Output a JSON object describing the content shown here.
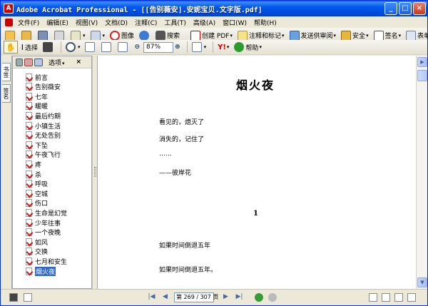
{
  "window": {
    "title": "Adobe Acrobat Professional - [[告别薇安].安妮宝贝.文字版.pdf]",
    "app_icon": "A"
  },
  "menu": [
    "文件(F)",
    "编辑(E)",
    "视图(V)",
    "文档(D)",
    "注释(C)",
    "工具(T)",
    "高级(A)",
    "窗口(W)",
    "帮助(H)"
  ],
  "toolbar1": {
    "picture_label": "图像",
    "search_label": "搜索",
    "create_pdf_label": "创建 PDF",
    "comment_label": "注释和标记",
    "review_label": "发送供审阅",
    "security_label": "安全",
    "sign_label": "签名",
    "forms_label": "表单"
  },
  "toolbar2": {
    "select_label": "选择",
    "zoom_value": "87%",
    "help_label": "帮助"
  },
  "panel": {
    "options_label": "选项",
    "close_glyph": "×",
    "tab1": "书签",
    "tab2": "签名",
    "bookmarks": [
      "前言",
      "告别薇安",
      "七年",
      "暖暖",
      "最后约期",
      "小镇生活",
      "无处告别",
      "下坠",
      "午夜飞行",
      "疼",
      "杀",
      "呼吸",
      "空城",
      "伤口",
      "生命是幻觉",
      "少年往事",
      "一个夜晚",
      "如风",
      "交换",
      "七月和安生",
      "烟火夜"
    ],
    "selected_index": 20
  },
  "document": {
    "title": "烟火夜",
    "lines": [
      "看见的，熄灭了",
      "消失的，记住了",
      "……",
      "——彼岸花"
    ],
    "page_number": "1",
    "lines2": [
      "如果时间倒退五年",
      "如果时间倒退五年。"
    ]
  },
  "status": {
    "page_display": "第 269 / 307 页"
  },
  "colors": {
    "titlebar": "#0054e3",
    "selection": "#316ac5"
  }
}
